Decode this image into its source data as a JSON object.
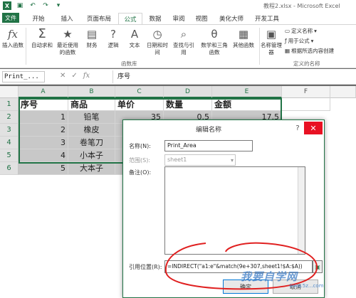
{
  "window": {
    "title": "教程2.xlsx - Microsoft Excel"
  },
  "tabs": [
    {
      "label": "文件"
    },
    {
      "label": "开始"
    },
    {
      "label": "插入"
    },
    {
      "label": "页面布局"
    },
    {
      "label": "公式"
    },
    {
      "label": "数据"
    },
    {
      "label": "审阅"
    },
    {
      "label": "视图"
    },
    {
      "label": "美化大师"
    },
    {
      "label": "开发工具"
    }
  ],
  "ribbon": {
    "insert_function": "插入函数",
    "autosum": "自动求和",
    "recent": "最近使用的函数",
    "financial": "财务",
    "logical": "逻辑",
    "text": "文本",
    "datetime": "日期和时间",
    "lookup": "查找与引用",
    "math": "数学和三角函数",
    "other": "其他函数",
    "group_library": "函数库",
    "name_manager": "名称管理器",
    "define_name": "定义名称",
    "use_in_formula": "用于公式",
    "create_from_selection": "根据所选内容创建",
    "group_defined_names": "定义的名称"
  },
  "formula_bar": {
    "name_box": "Print_...",
    "cancel": "✕",
    "enter": "✓",
    "fx": "fx",
    "formula": "序号"
  },
  "grid": {
    "columns": [
      "A",
      "B",
      "C",
      "D",
      "E",
      "F"
    ],
    "rows": [
      "1",
      "2",
      "3",
      "4",
      "5",
      "6"
    ],
    "header": [
      "序号",
      "商品",
      "单价",
      "数量",
      "金额"
    ],
    "data": [
      {
        "no": "1",
        "item": "铅笔",
        "price": "35",
        "qty": "0.5",
        "amount": "17.5"
      },
      {
        "no": "2",
        "item": "橡皮",
        "price": "",
        "qty": "",
        "amount": ""
      },
      {
        "no": "3",
        "item": "卷笔刀",
        "price": "",
        "qty": "",
        "amount": ""
      },
      {
        "no": "4",
        "item": "小本子",
        "price": "",
        "qty": "",
        "amount": ""
      },
      {
        "no": "5",
        "item": "大本子",
        "price": "",
        "qty": "",
        "amount": ""
      }
    ]
  },
  "dialog": {
    "title": "编辑名称",
    "help": "?",
    "close": "✕",
    "name_label": "名称(N):",
    "name_value": "Print_Area",
    "scope_label": "范围(S):",
    "scope_value": "sheet1",
    "comment_label": "备注(O):",
    "ref_label": "引用位置(R):",
    "ref_value": "=INDIRECT(\"a1:e\"&match(9e+307,sheet1!$A:$A))",
    "ok": "确定",
    "cancel": "取消"
  },
  "watermark": {
    "text": "我要自学网",
    "url": "www.5z...com"
  }
}
